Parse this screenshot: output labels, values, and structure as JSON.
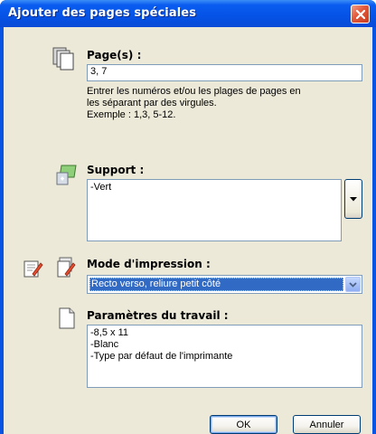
{
  "window": {
    "title": "Ajouter des pages spéciales"
  },
  "pages": {
    "label": "Page(s) :",
    "value": "3, 7",
    "help_lines": [
      "Entrer les numéros et/ou les plages de pages en",
      "les séparant par des virgules.",
      "Exemple : 1,3, 5-12."
    ]
  },
  "support": {
    "label": "Support :",
    "items": [
      "-Vert"
    ]
  },
  "mode": {
    "label": "Mode d'impression :",
    "selected": "Recto verso, reliure petit côté"
  },
  "job": {
    "label": "Paramètres du travail :",
    "items": [
      "-8,5 x 11",
      "-Blanc",
      "-Type par défaut de l'imprimante"
    ]
  },
  "buttons": {
    "ok": "OK",
    "cancel": "Annuler"
  }
}
